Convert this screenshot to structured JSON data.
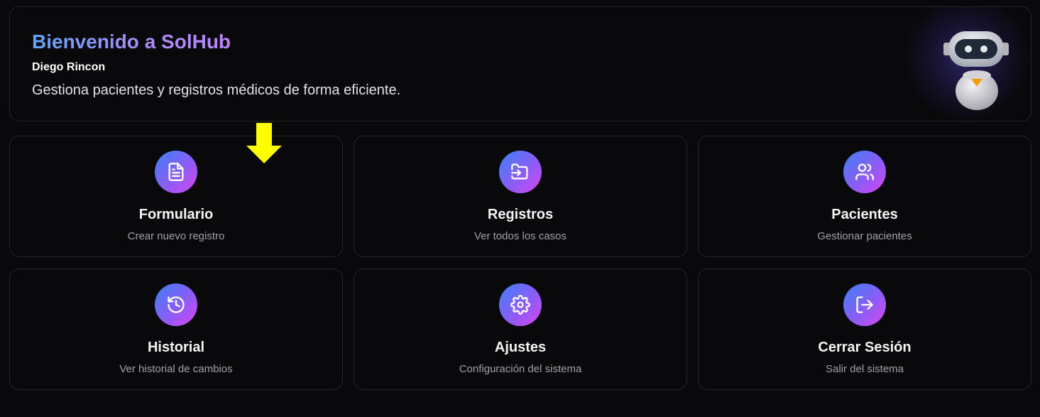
{
  "header": {
    "title": "Bienvenido a SolHub",
    "user_name": "Diego Rincon",
    "subtitle": "Gestiona pacientes y registros médicos de forma eficiente."
  },
  "tiles": [
    {
      "title": "Formulario",
      "description": "Crear nuevo registro",
      "icon": "file-text-icon"
    },
    {
      "title": "Registros",
      "description": "Ver todos los casos",
      "icon": "folder-input-icon"
    },
    {
      "title": "Pacientes",
      "description": "Gestionar pacientes",
      "icon": "users-icon"
    },
    {
      "title": "Historial",
      "description": "Ver historial de cambios",
      "icon": "history-icon"
    },
    {
      "title": "Ajustes",
      "description": "Configuración del sistema",
      "icon": "settings-gear-icon"
    },
    {
      "title": "Cerrar Sesión",
      "description": "Salir del sistema",
      "icon": "logout-icon"
    }
  ],
  "colors": {
    "background": "#09090b",
    "border": "#27272a",
    "gradient_start": "#3b82f6",
    "gradient_end": "#d946ef",
    "annotation_arrow": "#ffff00"
  }
}
